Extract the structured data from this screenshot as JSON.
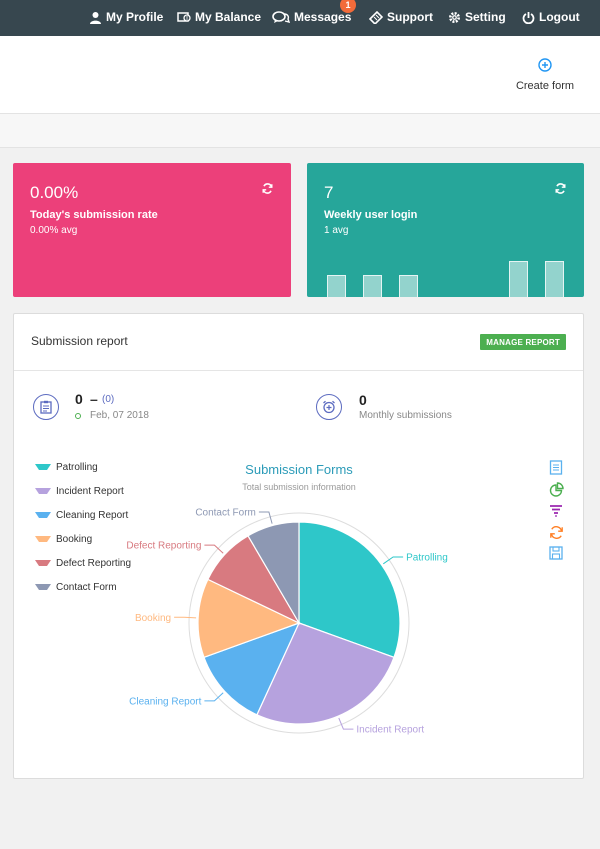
{
  "nav": {
    "my_profile": "My Profile",
    "my_balance": "My Balance",
    "messages": "Messages",
    "messages_badge": "1",
    "support": "Support",
    "setting": "Setting",
    "logout": "Logout"
  },
  "header": {
    "create_form": "Create form"
  },
  "cards": {
    "submission": {
      "value": "0.00%",
      "label": "Today's submission rate",
      "sub": "0.00% avg",
      "color": "#ec407a"
    },
    "login": {
      "value": "7",
      "label": "Weekly user login",
      "sub": "1 avg",
      "color": "#26a69a",
      "bar_levels": [
        0.6,
        0.6,
        0.6,
        0,
        0,
        1,
        1
      ]
    }
  },
  "report": {
    "title": "Submission report",
    "manage_button": "MANAGE REPORT",
    "daily": {
      "count": "0",
      "dash": "–",
      "paren": "(0)",
      "date": "Feb, 07 2018"
    },
    "monthly": {
      "count": "0",
      "label": "Monthly submissions"
    }
  },
  "chart_data": {
    "type": "pie",
    "title": "Submission Forms",
    "subtitle": "Total submission information",
    "categories": [
      "Patrolling",
      "Incident Report",
      "Cleaning Report",
      "Booking",
      "Defect Reporting",
      "Contact Form"
    ],
    "values": [
      29,
      25,
      12,
      12,
      9,
      8
    ],
    "colors": [
      "#2ec7c9",
      "#b6a2de",
      "#5ab1ef",
      "#ffb980",
      "#d87a80",
      "#8d98b3"
    ],
    "legend_position": "left",
    "toolbox": [
      "data-view-icon",
      "pie-toggle-icon",
      "funnel-icon",
      "restore-icon",
      "save-image-icon"
    ]
  }
}
